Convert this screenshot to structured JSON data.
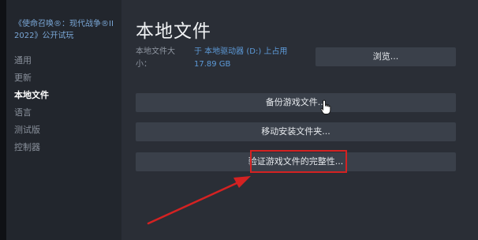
{
  "sidebar": {
    "game_title": "《使命召唤®：现代战争®II 2022》公开试玩",
    "items": [
      {
        "label": "通用"
      },
      {
        "label": "更新"
      },
      {
        "label": "本地文件"
      },
      {
        "label": "语言"
      },
      {
        "label": "测试版"
      },
      {
        "label": "控制器"
      }
    ],
    "active_index": 2
  },
  "main": {
    "title": "本地文件",
    "size_label": "本地文件大小：",
    "size_value": "于 本地驱动器 (D:) 上占用 17.89 GB",
    "browse_label": "浏览...",
    "backup_label": "备份游戏文件...",
    "move_label": "移动安装文件夹...",
    "verify_label": "验证游戏文件的完整性..."
  },
  "annotation": {
    "highlight_color": "#d42222",
    "arrow_color": "#d42222"
  },
  "colors": {
    "sidebar_bg": "#22262d",
    "main_bg": "#2a2e36",
    "button_bg": "#3a404a",
    "link_blue": "#5d9ad8"
  }
}
